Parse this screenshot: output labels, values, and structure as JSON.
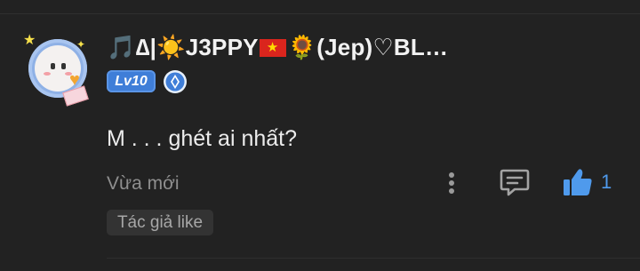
{
  "comment": {
    "author": {
      "name_parts": {
        "prefix": "🎵∆|",
        "handle": "J3PPY",
        "suffix": "(Jep)♡BL…"
      },
      "level": "Lv10"
    },
    "text": "M . . . ghét ai nhất?",
    "timestamp": "Vừa mới",
    "likes": "1",
    "author_tag": "Tác giả like"
  },
  "icons": {
    "avatar": "avatar-image",
    "badge": "verified-badge-icon",
    "more": "more-vertical-icon",
    "reply": "reply-icon",
    "like": "thumbs-up-icon"
  },
  "colors": {
    "background": "#222222",
    "accent": "#4f9aec",
    "level_badge": "#3f7ed8",
    "muted_text": "#8f8f8f",
    "tag_background": "#333333"
  }
}
